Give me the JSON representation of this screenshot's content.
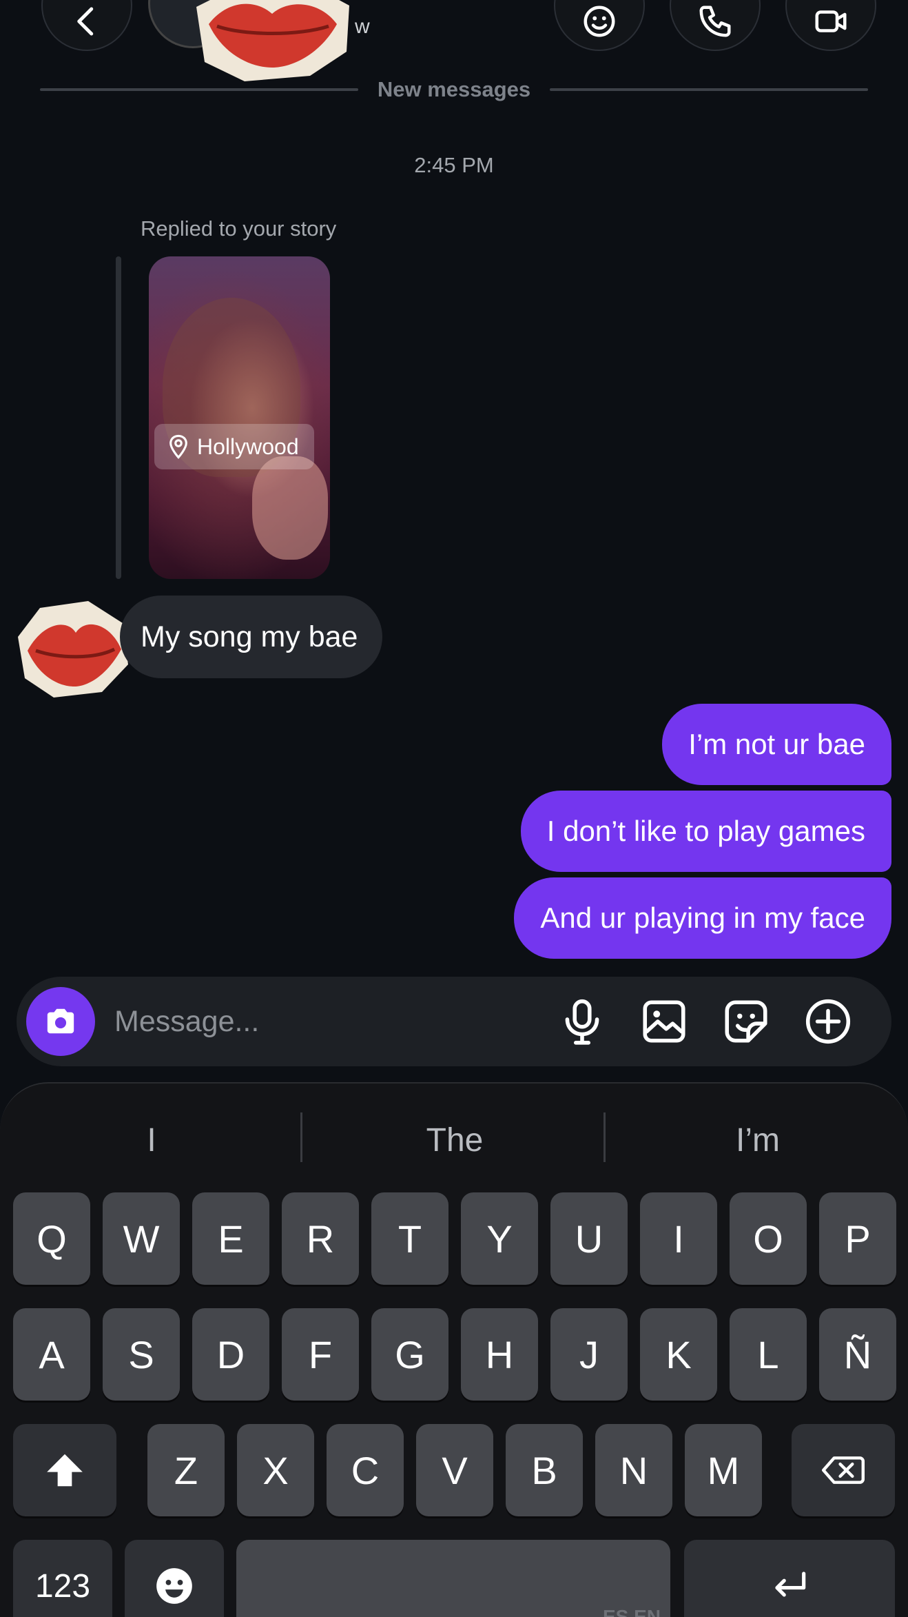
{
  "header": {
    "back_icon": "chevron-left-icon",
    "name_fragment": "w",
    "action_icons": [
      "effects-icon",
      "phone-icon",
      "video-icon"
    ]
  },
  "divider": {
    "new_messages_label": "New messages"
  },
  "conversation": {
    "timestamp": "2:45 PM",
    "story_reply": {
      "label": "Replied to your story",
      "location": "Hollywood"
    },
    "incoming": [
      {
        "text": "My song my bae"
      }
    ],
    "outgoing": [
      {
        "text": "I’m not ur bae"
      },
      {
        "text": "I don’t like to play games"
      },
      {
        "text": "And ur playing in my face"
      }
    ]
  },
  "composer": {
    "placeholder": "Message...",
    "accent_color": "#7436ef",
    "icons": [
      "camera-icon",
      "microphone-icon",
      "gallery-icon",
      "sticker-icon",
      "plus-circle-icon"
    ]
  },
  "keyboard": {
    "suggestions": [
      "I",
      "The",
      "I’m"
    ],
    "row1": [
      "Q",
      "W",
      "E",
      "R",
      "T",
      "Y",
      "U",
      "I",
      "O",
      "P"
    ],
    "row2": [
      "A",
      "S",
      "D",
      "F",
      "G",
      "H",
      "J",
      "K",
      "L",
      "Ñ"
    ],
    "row3": [
      "Z",
      "X",
      "C",
      "V",
      "B",
      "N",
      "M"
    ],
    "numbers_key": "123",
    "space_language": "ES EN"
  },
  "colors": {
    "background": "#0c0f14",
    "outgoing_bubble": "#7436ef",
    "incoming_bubble": "#25282e"
  }
}
